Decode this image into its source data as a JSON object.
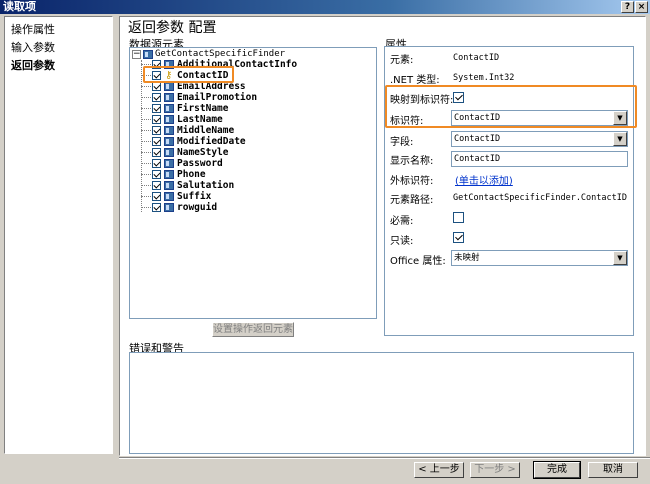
{
  "window": {
    "title": "读取项",
    "help_button": "?",
    "close_button": "×"
  },
  "nav": {
    "items": [
      {
        "label": "操作属性"
      },
      {
        "label": "输入参数"
      },
      {
        "label": "返回参数"
      }
    ]
  },
  "page": {
    "title": "返回参数 配置"
  },
  "tree": {
    "group_label": "数据源元素",
    "root": "GetContactSpecificFinder",
    "nodes": [
      {
        "label": "AdditionalContactInfo"
      },
      {
        "label": "ContactID"
      },
      {
        "label": "EmailAddress"
      },
      {
        "label": "EmailPromotion"
      },
      {
        "label": "FirstName"
      },
      {
        "label": "LastName"
      },
      {
        "label": "MiddleName"
      },
      {
        "label": "ModifiedDate"
      },
      {
        "label": "NameStyle"
      },
      {
        "label": "Password"
      },
      {
        "label": "Phone"
      },
      {
        "label": "Salutation"
      },
      {
        "label": "Suffix"
      },
      {
        "label": "rowguid"
      }
    ],
    "set_button": "设置操作返回元素"
  },
  "properties": {
    "group_label": "属性",
    "element_label": "元素:",
    "element_value": "ContactID",
    "nettype_label": ".NET 类型:",
    "nettype_value": "System.Int32",
    "map_to_identifier_label": "映射到标识符:",
    "identifier_label": "标识符:",
    "identifier_value": "ContactID",
    "field_label": "字段:",
    "field_value": "ContactID",
    "display_name_label": "显示名称:",
    "display_name_value": "ContactID",
    "foreign_id_label": "外标识符:",
    "foreign_id_link": "(单击以添加)",
    "element_path_label": "元素路径:",
    "element_path_value": "GetContactSpecificFinder.ContactID",
    "required_label": "必需:",
    "readonly_label": "只读:",
    "office_label": "Office 属性:",
    "office_value": "未映射"
  },
  "errors": {
    "group_label": "错误和警告"
  },
  "buttons": {
    "back": "< 上一步",
    "next": "下一步 >",
    "finish": "完成",
    "cancel": "取消"
  },
  "colors": {
    "highlight": "#f08a24",
    "title_bar": "#0a246a",
    "link": "#0033cc"
  }
}
